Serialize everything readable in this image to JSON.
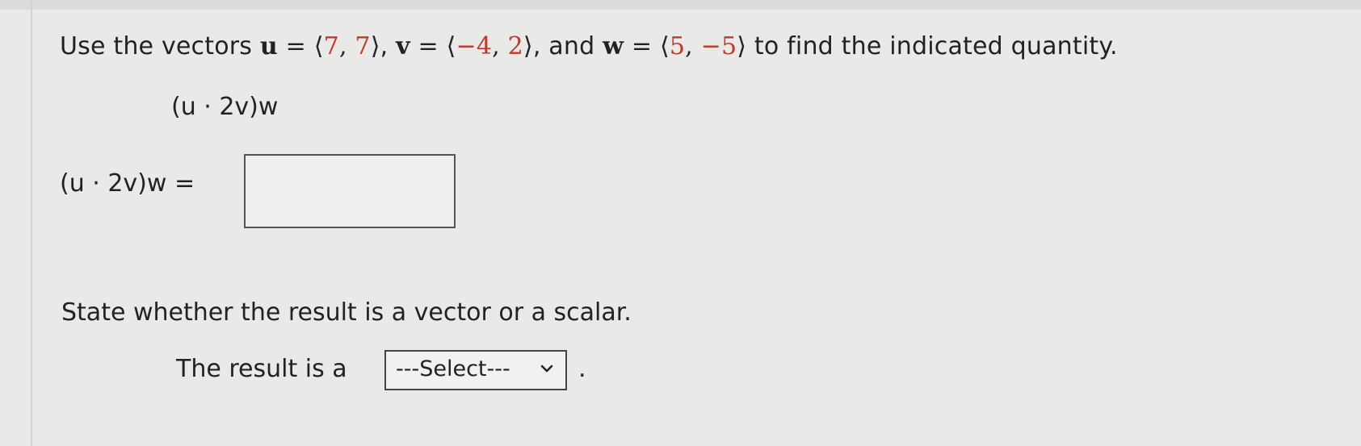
{
  "prompt": {
    "lead": "Use the vectors",
    "u_name": "u",
    "u_value_open": "⟨",
    "u_x": "7",
    "u_y": "7",
    "u_value_close": "⟩",
    "v_name": "v",
    "v_x": "−4",
    "v_y": "2",
    "and_text": ", and",
    "w_name": "w",
    "w_x": "5",
    "w_y": "−5",
    "tail": "to find the indicated quantity."
  },
  "expression": {
    "display": "(u · 2v)w",
    "answer_label": "(u · 2v)w ="
  },
  "answer": {
    "value": ""
  },
  "scalar_question": {
    "text": "State whether the result is a vector or a scalar."
  },
  "result": {
    "label": "The result is a",
    "select_value": "---Select---",
    "period": "."
  },
  "colors": {
    "value_red": "#c0392b",
    "text": "#222222",
    "background": "#e9e9e7"
  },
  "icons": {
    "dropdown": "chevron-down-icon"
  }
}
